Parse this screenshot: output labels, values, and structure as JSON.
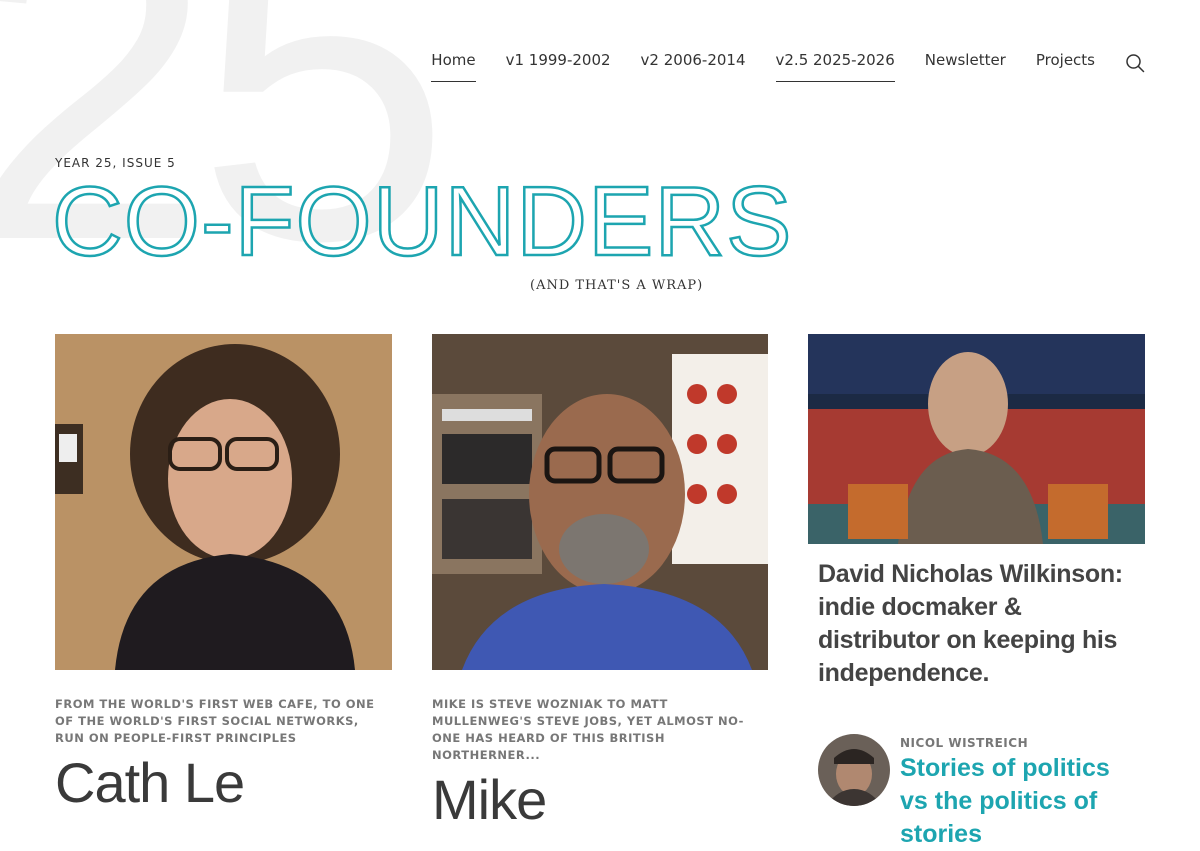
{
  "background_number": "25",
  "nav": {
    "items": [
      {
        "label": "Home",
        "active": true
      },
      {
        "label": "v1 1999-2002",
        "active": false
      },
      {
        "label": "v2 2006-2014",
        "active": false
      },
      {
        "label": "v2.5 2025-2026",
        "active": true
      },
      {
        "label": "Newsletter",
        "active": false
      },
      {
        "label": "Projects",
        "active": false
      }
    ],
    "search_icon": "search-icon"
  },
  "header": {
    "issue_label": "YEAR 25, ISSUE 5",
    "title": "CO-FOUNDERS",
    "subtitle": "(AND THAT'S A WRAP)"
  },
  "cards": [
    {
      "kicker": "FROM THE WORLD'S FIRST WEB CAFE, TO ONE OF THE WORLD'S FIRST SOCIAL NETWORKS, RUN ON PEOPLE-FIRST PRINCIPLES",
      "name": "Cath Le"
    },
    {
      "kicker": "MIKE IS STEVE WOZNIAK TO MATT MULLENWEG'S STEVE JOBS, YET ALMOST NO-ONE HAS HEARD OF THIS BRITISH NORTHERNER...",
      "name": "Mike"
    }
  ],
  "feature": {
    "title": "David Nicholas Wilkinson: indie docmaker & distributor on keeping his independence.",
    "related": {
      "author": "NICOL WISTREICH",
      "title": "Stories of politics vs the politics of stories"
    }
  },
  "colors": {
    "accent": "#1da5b0",
    "text": "#3a3a3a",
    "muted": "#777777"
  }
}
